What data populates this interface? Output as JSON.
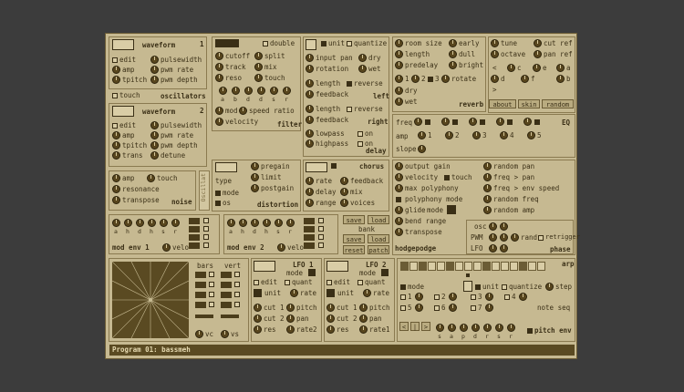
{
  "program": {
    "label": "Program 01: bassmeh"
  },
  "osc1": {
    "number": "1",
    "waveform": "waveform",
    "edit": "edit",
    "pulsewidth": "pulsewidth",
    "amp": "amp",
    "pwm_rate": "pwm rate",
    "tpitch": "tpitch",
    "pwm_depth": "pwm depth",
    "touch": "touch",
    "section": "oscillators"
  },
  "osc2": {
    "number": "2",
    "waveform": "waveform",
    "edit": "edit",
    "pulsewidth": "pulsewidth",
    "amp": "amp",
    "pwm_rate": "pwm rate",
    "tpitch": "tpitch",
    "pwm_depth": "pwm depth",
    "trans": "trans",
    "detune": "detune"
  },
  "noise": {
    "amp": "amp",
    "touch": "touch",
    "resonance": "resonance",
    "transpose": "transpose",
    "section": "noise",
    "sidetab": "Oscillat"
  },
  "filter": {
    "double": "double",
    "cutoff": "cutoff",
    "split": "split",
    "track": "track",
    "mix": "mix",
    "reso": "reso",
    "touch": "touch",
    "steps": [
      "a",
      "b",
      "d",
      "d",
      "s",
      "r"
    ],
    "mod": "mod",
    "speed_ratio": "speed ratio",
    "velocity": "velocity",
    "section": "filter"
  },
  "delay": {
    "unit": "unit",
    "quantize": "quantize",
    "input_pan": "input pan",
    "dry": "dry",
    "rotation": "rotation",
    "wet": "wet",
    "length": "length",
    "reverse": "reverse",
    "feedback": "feedback",
    "left": "left",
    "right": "right",
    "lowpass": "lowpass",
    "on": "on",
    "highpass": "highpass",
    "section": "delay"
  },
  "reverb": {
    "room_size": "room size",
    "early": "early",
    "length": "length",
    "dull": "dull",
    "predelay": "predelay",
    "bright": "bright",
    "taps": [
      "1",
      "2",
      "3"
    ],
    "rotate": "rotate",
    "dry": "dry",
    "wet": "wet",
    "section": "reverb"
  },
  "misc": {
    "tune": "tune",
    "cut_ref": "cut ref",
    "octave": "octave",
    "pan_ref": "pan ref",
    "letters": [
      "<",
      "c",
      "e",
      "a",
      ">",
      "d",
      "f",
      "b"
    ],
    "about": "about",
    "skin": "skin",
    "random": "random"
  },
  "eq": {
    "freq": "freq",
    "amp": "amp",
    "slope": "slope",
    "bands": [
      "1",
      "2",
      "3",
      "4",
      "5"
    ],
    "section": "EQ"
  },
  "distortion": {
    "pregain": "pregain",
    "type": "type",
    "limit": "limit",
    "mode": "mode",
    "postgain": "postgain",
    "os": "os",
    "section": "distortion"
  },
  "chorus": {
    "rate": "rate",
    "feedback": "feedback",
    "delay": "delay",
    "mix": "mix",
    "range": "range",
    "voices": "voices",
    "section": "chorus"
  },
  "hodgepodge": {
    "output_gain": "output gain",
    "random_pan": "random pan",
    "velocity": "velocity",
    "touch": "touch",
    "freq_pan": "freq > pan",
    "max_polyphony": "max polyphony",
    "freq_env_speed": "freq > env speed",
    "polyphony_mode": "polyphony mode",
    "random_freq": "random freq",
    "glide": "glide",
    "mode": "mode",
    "random_amp": "random amp",
    "bend_range": "bend range",
    "transpose": "transpose",
    "section": "hodgepodge"
  },
  "phase": {
    "osc": "osc",
    "pwm": "PWM",
    "rand": "rand",
    "retrigger": "retrigger",
    "lfo": "LFO",
    "section": "phase"
  },
  "modenv1": {
    "steps": [
      "a",
      "h",
      "d",
      "h",
      "s",
      "r"
    ],
    "velo": "velo",
    "section": "mod env 1"
  },
  "modenv2": {
    "steps": [
      "a",
      "h",
      "d",
      "h",
      "s",
      "r"
    ],
    "velo": "velo",
    "section": "mod env 2"
  },
  "patch": {
    "save": "save",
    "load": "load",
    "bank": "bank",
    "reset": "reset",
    "patch": "patch"
  },
  "xy": {
    "bars": "bars",
    "vert": "vert",
    "vc": "vc",
    "vs": "vs"
  },
  "lfo1": {
    "title": "LFO 1",
    "mode": "mode",
    "edit": "edit",
    "quant": "quant",
    "unit": "unit",
    "rate": "rate",
    "cut1": "cut 1",
    "pitch": "pitch",
    "cut2": "cut 2",
    "pan": "pan",
    "res": "res",
    "rate2": "rate2"
  },
  "lfo2": {
    "title": "LFO 2",
    "mode": "mode",
    "edit": "edit",
    "quant": "quant",
    "unit": "unit",
    "rate": "rate",
    "cut1": "cut 1",
    "pitch": "pitch",
    "cut2": "cut 2",
    "pan": "pan",
    "res": "res",
    "rate1": "rate1"
  },
  "arp": {
    "title": "arp",
    "mode": "mode",
    "unit": "unit",
    "quantize": "quantize",
    "step": "step",
    "nums": [
      "1",
      "2",
      "3",
      "4",
      "5",
      "6",
      "7"
    ],
    "note_seq": "note seq",
    "pitch_env": "pitch env",
    "env_steps": [
      "s",
      "a",
      "p",
      "d",
      "r",
      "s",
      "r"
    ]
  }
}
